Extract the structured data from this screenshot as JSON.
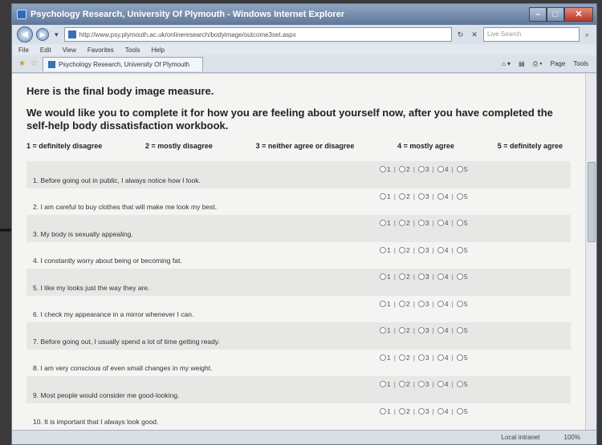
{
  "window": {
    "title": "Psychology Research, University Of Plymouth - Windows Internet Explorer",
    "url": "http://www.psy.plymouth.ac.uk/onlineresearch/bodyimage/outcome3set.aspx",
    "search_placeholder": "Live Search",
    "menu": [
      "File",
      "Edit",
      "View",
      "Favorites",
      "Tools",
      "Help"
    ],
    "tab_title": "Psychology Research, University Of Plymouth",
    "tools": [
      "Page",
      "Tools"
    ],
    "status_zone": "Local intranet",
    "zoom": "100%"
  },
  "page": {
    "heading": "Here is the final body image measure.",
    "subheading": "We would like you to complete it for how you are feeling about yourself now, after you have completed the self-help body dissatisfaction workbook.",
    "scale": [
      "1 = definitely disagree",
      "2 = mostly disagree",
      "3 = neither agree or disagree",
      "4 = mostly agree",
      "5 = definitely agree"
    ],
    "options": [
      "1",
      "2",
      "3",
      "4",
      "5"
    ],
    "items": [
      "1. Before going out in public, I always notice how I look.",
      "2. I am careful to buy clothes that will make me look my best.",
      "3. My body is sexually appealing.",
      "4. I constantly worry about being or becoming fat.",
      "5. I like my looks just the way they are.",
      "6. I check my appearance in a mirror whenever I can.",
      "7. Before going out, I usually spend a lot of time getting ready.",
      "8. I am very conscious of even small changes in my weight.",
      "9. Most people would consider me good-looking.",
      "10. It is important that I always look good."
    ]
  }
}
